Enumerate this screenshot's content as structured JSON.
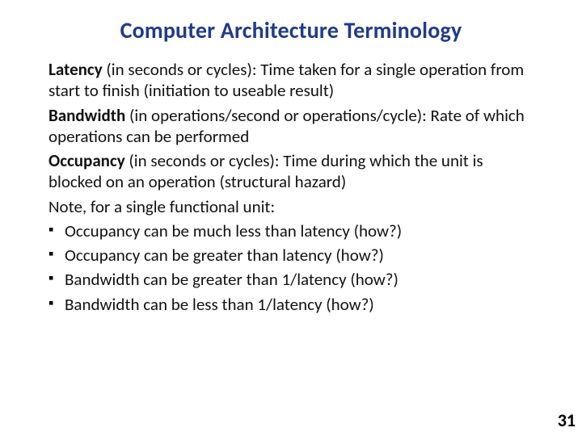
{
  "title": "Computer Architecture Terminology",
  "definitions": [
    {
      "term": "Latency",
      "desc": " (in seconds or cycles):  Time taken for a single operation from start to finish (initiation to useable result)"
    },
    {
      "term": "Bandwidth",
      "desc": " (in operations/second or operations/cycle): Rate of which operations can be performed"
    },
    {
      "term": "Occupancy",
      "desc": " (in seconds or cycles): Time during which the unit is blocked on an operation (structural hazard)"
    }
  ],
  "note": "Note, for a single functional unit:",
  "bullets": [
    "Occupancy can be much less than latency (how?)",
    "Occupancy can be greater than latency (how?)",
    "Bandwidth can be greater than 1/latency (how?)",
    "Bandwidth can be less than 1/latency (how?)"
  ],
  "page_number": "31"
}
